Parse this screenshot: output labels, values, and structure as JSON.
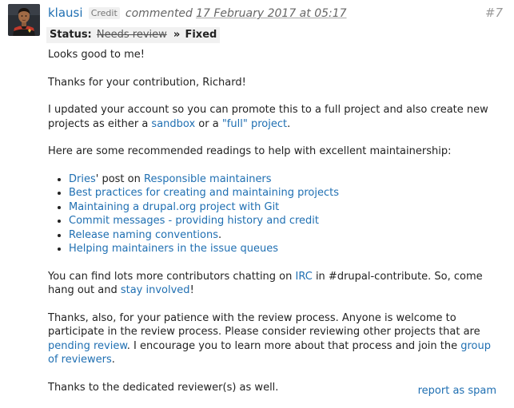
{
  "comment": {
    "author": "klausi",
    "credit_label": "Credit",
    "commented_label": "commented",
    "date": "17 February 2017 at 05:17",
    "permalink": "#7",
    "avatar": "star-trek-uniform-avatar",
    "status": {
      "label": "Status:",
      "old": "Needs review",
      "arrow": "»",
      "new": "Fixed"
    },
    "p1": "Looks good to me!",
    "p2": "Thanks for your contribution, Richard!",
    "p3": {
      "t1": "I updated your account so you can promote this to a full project and also create new projects as either a ",
      "sandbox_link": "sandbox",
      "t2": " or a ",
      "full_link": "\"full\" project",
      "t3": "."
    },
    "p4": "Here are some recommended readings to help with excellent maintainership:",
    "readings": {
      "item1": {
        "dries_link": "Dries",
        "t1": "' post on ",
        "link": "Responsible maintainers"
      },
      "item2": "Best practices for creating and maintaining projects",
      "item3": "Maintaining a drupal.org project with Git",
      "item4": "Commit messages - providing history and credit",
      "item5": {
        "link": "Release naming conventions",
        "t1": "."
      },
      "item6": "Helping maintainers in the issue queues"
    },
    "p5": {
      "t1": "You can find lots more contributors chatting on ",
      "irc_link": "IRC",
      "t2": " in #drupal-contribute. So, come hang out and ",
      "involved_link": "stay involved",
      "t3": "!"
    },
    "p6": {
      "t1": "Thanks, also, for your patience with the review process. Anyone is welcome to participate in the review process. Please consider reviewing other projects that are ",
      "pending_link": "pending review",
      "t2": ". I encourage you to learn more about that process and join the ",
      "group_link": "group of reviewers",
      "t3": "."
    },
    "p7": "Thanks to the dedicated reviewer(s) as well.",
    "report_label": "report as spam"
  },
  "colors": {
    "link": "#1f6fb2",
    "text": "#222222",
    "status_bg": "#f1f1f1",
    "meta": "#666666"
  }
}
